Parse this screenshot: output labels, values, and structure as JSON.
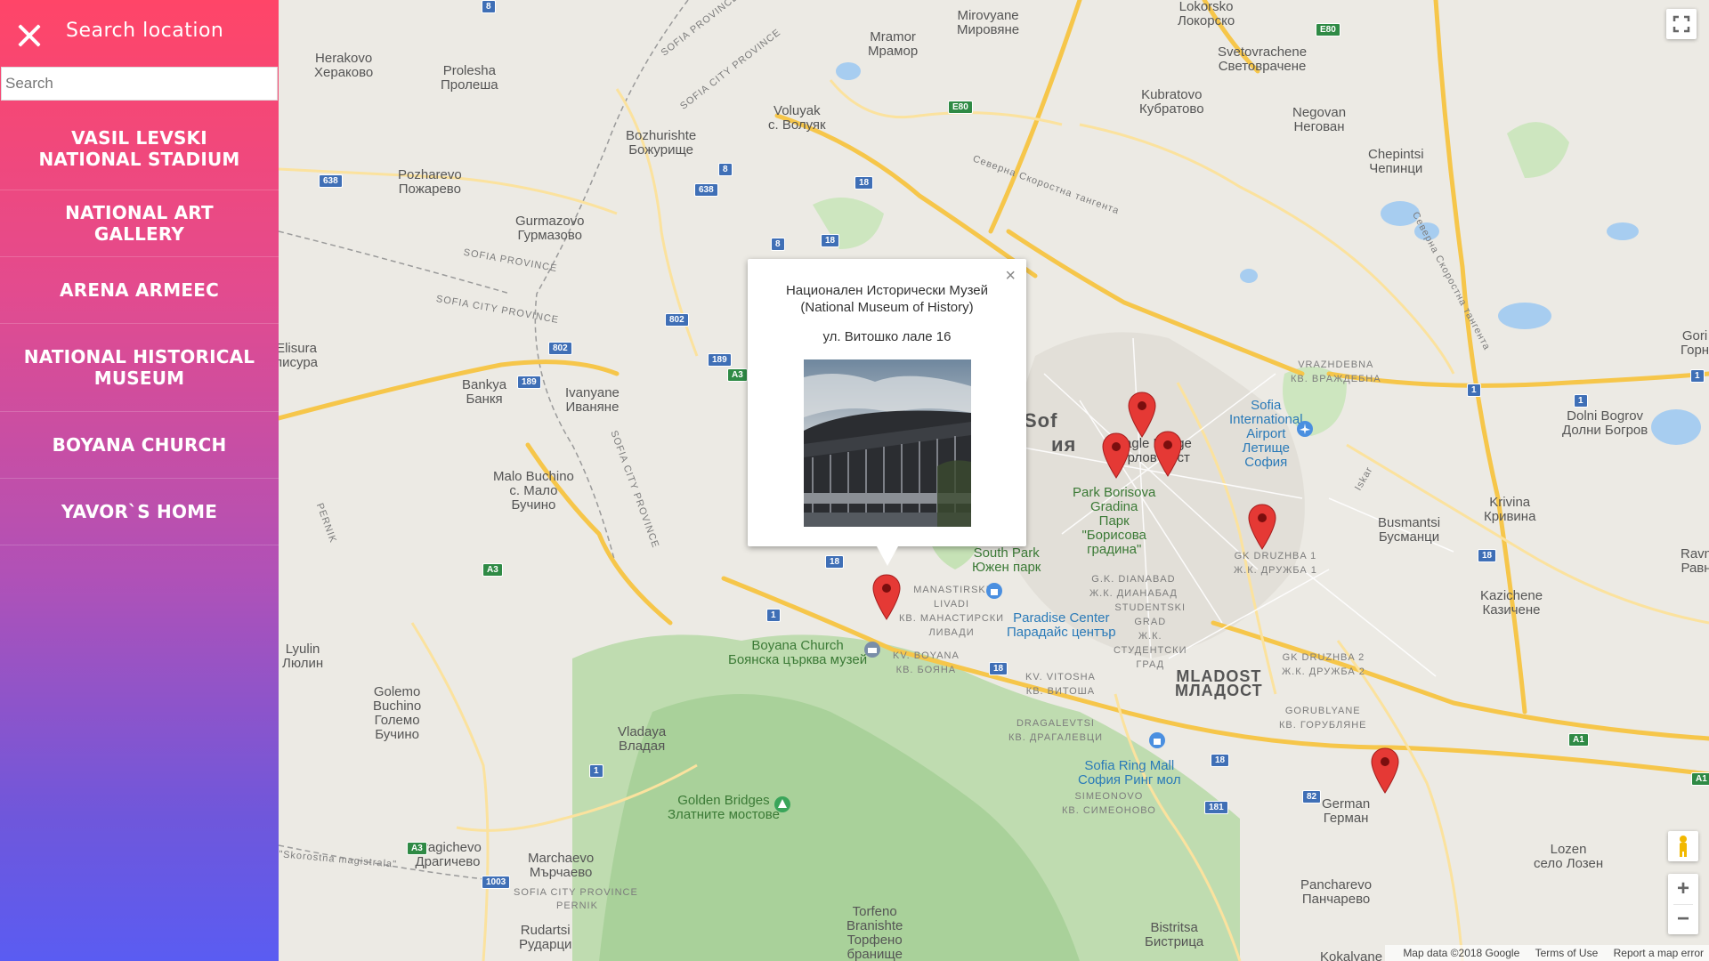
{
  "sidebar": {
    "title": "Search location",
    "search_placeholder": "Search",
    "items": [
      {
        "label": "VASIL LEVSKI NATIONAL STADIUM"
      },
      {
        "label": "NATIONAL ART GALLERY"
      },
      {
        "label": "ARENA ARMEEC"
      },
      {
        "label": "NATIONAL HISTORICAL MUSEUM"
      },
      {
        "label": "BOYANA CHURCH"
      },
      {
        "label": "YAVOR`S HOME"
      }
    ]
  },
  "infowindow": {
    "title_line1": "Национален Исторически Музей",
    "title_line2": "(National Museum of History)",
    "address": "ул. Витошко лале 16",
    "close_glyph": "×"
  },
  "map": {
    "labels": [
      "Herakovo",
      "Хераково",
      "Prolesha",
      "Пролеша",
      "Mramor",
      "Мрамор",
      "Mirovyane",
      "Мировяне",
      "Lokorsko",
      "Локорско",
      "Svetovrachene",
      "Световрачене",
      "Kubratovo",
      "Кубратово",
      "Negovan",
      "Негован",
      "Chepintsi",
      "Чепинци",
      "Voluyak",
      "с. Волуяк",
      "Bozhurishte",
      "Божурище",
      "Pozharevo",
      "Пожарево",
      "Gurmazovo",
      "Гурмазово",
      "Bankya",
      "Банкя",
      "Ivanyane",
      "Иваняне",
      "Malo Buchino",
      "с. Мало",
      "Бучино",
      "Lyulin",
      "Люлин",
      "Golemo",
      "Buchino",
      "Големо",
      "Бучино",
      "Vladaya",
      "Владая",
      "Dragichevo",
      "Драгичево",
      "Marchaevo",
      "Мърчаево",
      "Rudartsi",
      "Рударци",
      "Torfeno",
      "Branishte",
      "Торфено",
      "бранище",
      "Golden Bridges",
      "Златните мостове",
      "Boyana Church",
      "Боянска църква музей",
      "South Park",
      "Южен парк",
      "Paradise Center",
      "Парадайс център",
      "Eagle Bridge",
      "Орлов мост",
      "Park Borisova",
      "Gradina",
      "Парк",
      "\"Борисова",
      "градина\"",
      "Sofia",
      "International",
      "Airport",
      "Летище",
      "София",
      "Busmantsi",
      "Бусманци",
      "Dolni Bogrov",
      "Долни Богров",
      "Krivina",
      "Кривина",
      "Kazichene",
      "Казичене",
      "German",
      "Герман",
      "Lozen",
      "село Лозен",
      "Pancharevo",
      "Панчарево",
      "Bistritsa",
      "Бистрица",
      "Sofia Ring Mall",
      "София Ринг мол",
      "MLADOST",
      "МЛАДОСТ",
      "Sof",
      "ия",
      "SOFIA PROVINCE",
      "SOFIA CITY PROVINCE",
      "PERNIK",
      "Северна Скоростна тангента",
      "MANASTIRSKI",
      "LIVADI",
      "КВ. МАНАСТИРСКИ",
      "ЛИВАДИ",
      "VRAZHDEBNA",
      "КВ. ВРАЖДЕБНА",
      "G.K. DIANABAD",
      "Ж.К. ДИАНАБАД",
      "STUDENTSKI",
      "GRAD",
      "Ж.К.",
      "СТУДЕНТСКИ",
      "ГРАД",
      "KV. VITOSHA",
      "КВ. ВИТОША",
      "DRAGALEVTSI",
      "КВ. ДРАГАЛЕВЦИ",
      "SIMEONOVO",
      "КВ. СИМЕОНОВО",
      "GK DRUZHBA 1",
      "Ж.К. ДРУЖБА 1",
      "GK DRUZHBA 2",
      "Ж.К. ДРУЖБА 2",
      "GORUBLYANE",
      "КВ. ГОРУБЛЯНЕ",
      "KV. BOYANA",
      "КВ. БОЯНА",
      "Elisura",
      "писура",
      "Gori",
      "Горн",
      "Ravn",
      "Равн",
      "Kokalyane",
      "Iskar",
      "\"Skorostna magistrala\""
    ],
    "shields": [
      "8",
      "638",
      "8",
      "638",
      "18",
      "18",
      "8",
      "18",
      "E80",
      "E80",
      "802",
      "802",
      "189",
      "189",
      "A3",
      "A3",
      "A3",
      "18",
      "1",
      "18",
      "18",
      "181",
      "82",
      "1",
      "1",
      "18",
      "1003",
      "A1",
      "A1",
      "1",
      "1"
    ],
    "attribution": {
      "data": "Map data ©2018 Google",
      "terms": "Terms of Use",
      "report": "Report a map error"
    },
    "controls": {
      "zoom_in": "+",
      "zoom_out": "−"
    }
  }
}
